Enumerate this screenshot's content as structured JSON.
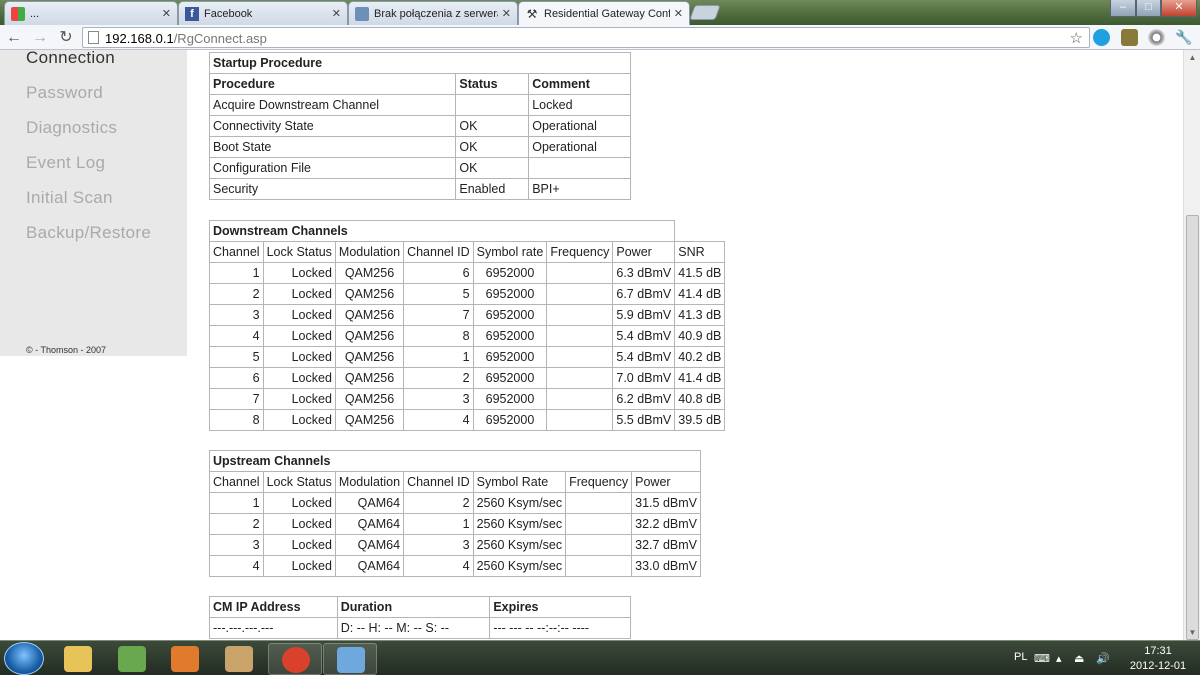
{
  "browser": {
    "tabs": [
      {
        "title": "...",
        "icon": "windows-flag-icon",
        "active": false
      },
      {
        "title": "Facebook",
        "icon": "facebook-icon",
        "active": false
      },
      {
        "title": "Brak połączenia z serweram",
        "icon": "tools-icon",
        "active": false
      },
      {
        "title": "Residential Gateway Confi",
        "icon": "hammer-wrench-icon",
        "active": true
      }
    ],
    "address": {
      "host": "192.168.0.1",
      "path": "/RgConnect.asp"
    },
    "window_buttons": [
      "–",
      "□",
      "✕"
    ]
  },
  "sidebar": {
    "items": [
      {
        "label": "Connection",
        "current": true
      },
      {
        "label": "Password"
      },
      {
        "label": "Diagnostics"
      },
      {
        "label": "Event Log"
      },
      {
        "label": "Initial Scan"
      },
      {
        "label": "Backup/Restore"
      }
    ],
    "copyright": "© - Thomson - 2007"
  },
  "startup": {
    "title": "Startup Procedure",
    "headers": [
      "Procedure",
      "Status",
      "Comment"
    ],
    "rows": [
      [
        "Acquire Downstream Channel",
        "",
        "Locked"
      ],
      [
        "Connectivity State",
        "OK",
        "Operational"
      ],
      [
        "Boot State",
        "OK",
        "Operational"
      ],
      [
        "Configuration File",
        "OK",
        ""
      ],
      [
        "Security",
        "Enabled",
        "BPI+"
      ]
    ]
  },
  "downstream": {
    "title": "Downstream Channels",
    "headers": [
      "Channel",
      "Lock Status",
      "Modulation",
      "Channel ID",
      "Symbol rate",
      "Frequency",
      "Power",
      "SNR"
    ],
    "rows": [
      [
        "1",
        "Locked",
        "QAM256",
        "6",
        "6952000",
        "",
        "6.3 dBmV",
        "41.5 dB"
      ],
      [
        "2",
        "Locked",
        "QAM256",
        "5",
        "6952000",
        "",
        "6.7 dBmV",
        "41.4 dB"
      ],
      [
        "3",
        "Locked",
        "QAM256",
        "7",
        "6952000",
        "",
        "5.9 dBmV",
        "41.3 dB"
      ],
      [
        "4",
        "Locked",
        "QAM256",
        "8",
        "6952000",
        "",
        "5.4 dBmV",
        "40.9 dB"
      ],
      [
        "5",
        "Locked",
        "QAM256",
        "1",
        "6952000",
        "",
        "5.4 dBmV",
        "40.2 dB"
      ],
      [
        "6",
        "Locked",
        "QAM256",
        "2",
        "6952000",
        "",
        "7.0 dBmV",
        "41.4 dB"
      ],
      [
        "7",
        "Locked",
        "QAM256",
        "3",
        "6952000",
        "",
        "6.2 dBmV",
        "40.8 dB"
      ],
      [
        "8",
        "Locked",
        "QAM256",
        "4",
        "6952000",
        "",
        "5.5 dBmV",
        "39.5 dB"
      ]
    ]
  },
  "upstream": {
    "title": "Upstream Channels",
    "headers": [
      "Channel",
      "Lock Status",
      "Modulation",
      "Channel ID",
      "Symbol Rate",
      "Frequency",
      "Power"
    ],
    "rows": [
      [
        "1",
        "Locked",
        "QAM64",
        "2",
        "2560 Ksym/sec",
        "",
        "31.5 dBmV"
      ],
      [
        "2",
        "Locked",
        "QAM64",
        "1",
        "2560 Ksym/sec",
        "",
        "32.2 dBmV"
      ],
      [
        "3",
        "Locked",
        "QAM64",
        "3",
        "2560 Ksym/sec",
        "",
        "32.7 dBmV"
      ],
      [
        "4",
        "Locked",
        "QAM64",
        "4",
        "2560 Ksym/sec",
        "",
        "33.0 dBmV"
      ]
    ]
  },
  "cm": {
    "headers": [
      "CM IP Address",
      "Duration",
      "Expires"
    ],
    "values": [
      "---.---.---.---",
      "D: -- H: -- M: -- S: --",
      "--- --- -- --:--:-- ----"
    ]
  },
  "taskbar": {
    "apps": [
      {
        "name": "explorer-icon",
        "color": "#e8c35a",
        "open": false
      },
      {
        "name": "network-people-icon",
        "color": "#6aa84f",
        "open": false
      },
      {
        "name": "media-player-icon",
        "color": "#e07a2c",
        "open": false
      },
      {
        "name": "media-center-icon",
        "color": "#c9a36a",
        "open": false
      },
      {
        "name": "chrome-icon",
        "color": "#d9412c",
        "open": true
      },
      {
        "name": "paint-icon",
        "color": "#6fa8dc",
        "open": true
      }
    ],
    "lang": "PL",
    "time": "17:31",
    "date": "2012-12-01"
  },
  "colors": {
    "sidebar_bg": "#e8e8e8",
    "table_border": "#b5b5b5",
    "taskbar": "#2a3329"
  }
}
